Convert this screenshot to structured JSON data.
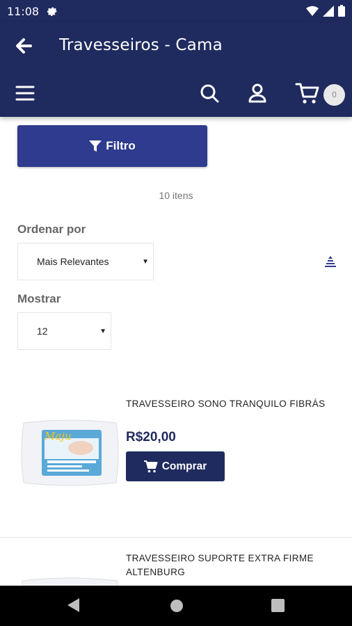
{
  "status_bar": {
    "time": "11:08"
  },
  "header": {
    "title": "Travesseiros - Cama",
    "cart_count": "0"
  },
  "filter_button": {
    "label": "Filtro"
  },
  "items_count": "10 itens",
  "sort": {
    "label": "Ordenar por",
    "selected": "Mais Relevantes"
  },
  "show": {
    "label": "Mostrar",
    "selected": "12"
  },
  "products": [
    {
      "name": "TRAVESSEIRO SONO TRANQUILO FIBRÁS",
      "price": "R$20,00",
      "buy_label": "Comprar",
      "image_text": "Maju"
    },
    {
      "name_line1": "TRAVESSEIRO SUPORTE EXTRA FIRME",
      "name_line2": "ALTENBURG"
    }
  ],
  "colors": {
    "primary": "#1f2a5e",
    "filter": "#2e3b8e",
    "background": "#ffffff"
  },
  "icons": [
    "gear-icon",
    "wifi-icon",
    "signal-icon",
    "battery-icon",
    "back-arrow-icon",
    "menu-icon",
    "search-icon",
    "user-icon",
    "cart-icon",
    "filter-icon",
    "sort-direction-icon",
    "nav-back-icon",
    "nav-home-icon",
    "nav-recents-icon"
  ]
}
